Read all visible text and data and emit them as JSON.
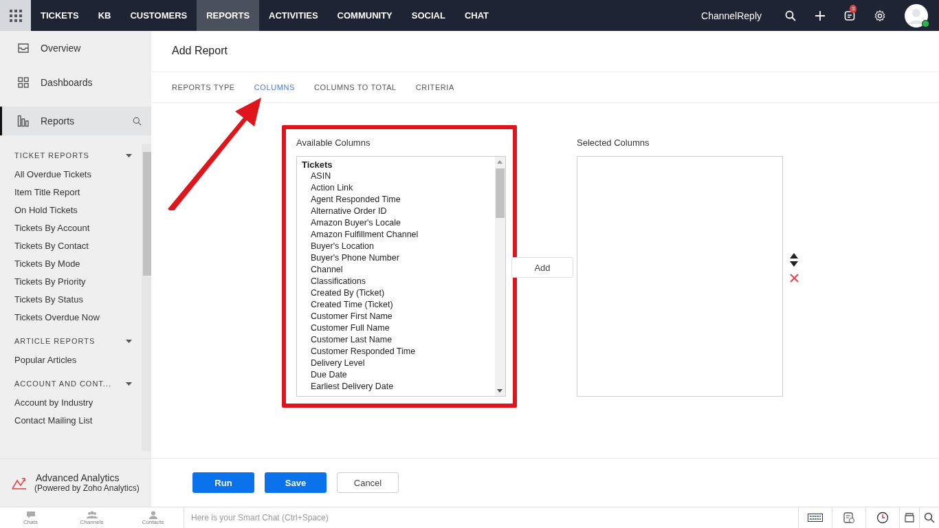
{
  "top_nav": {
    "tabs": [
      {
        "label": "TICKETS",
        "selected": false
      },
      {
        "label": "KB",
        "selected": false
      },
      {
        "label": "CUSTOMERS",
        "selected": false
      },
      {
        "label": "REPORTS",
        "selected": true
      },
      {
        "label": "ACTIVITIES",
        "selected": false
      },
      {
        "label": "COMMUNITY",
        "selected": false
      },
      {
        "label": "SOCIAL",
        "selected": false
      },
      {
        "label": "CHAT",
        "selected": false
      }
    ],
    "org": "ChannelReply",
    "notification_count": "3"
  },
  "sidebar": {
    "nav": [
      {
        "label": "Overview",
        "selected": false
      },
      {
        "label": "Dashboards",
        "selected": false
      },
      {
        "label": "Reports",
        "selected": true
      }
    ],
    "groups": [
      {
        "title": "TICKET REPORTS",
        "items": [
          "All Overdue Tickets",
          "Item Title Report",
          "On Hold Tickets",
          "Tickets By Account",
          "Tickets By Contact",
          "Tickets By Mode",
          "Tickets By Priority",
          "Tickets By Status",
          "Tickets Overdue Now"
        ]
      },
      {
        "title": "ARTICLE REPORTS",
        "items": [
          "Popular Articles"
        ]
      },
      {
        "title": "ACCOUNT AND CONT...",
        "items": [
          "Account by Industry",
          "Contact Mailing List"
        ]
      }
    ],
    "analytics": {
      "title": "Advanced Analytics",
      "subtitle": "(Powered by Zoho Analytics)"
    }
  },
  "page": {
    "title": "Add Report",
    "steps": [
      {
        "label": "REPORTS TYPE",
        "selected": false
      },
      {
        "label": "COLUMNS",
        "selected": true
      },
      {
        "label": "COLUMNS TO TOTAL",
        "selected": false
      },
      {
        "label": "CRITERIA",
        "selected": false
      }
    ],
    "available": {
      "label": "Available Columns",
      "group": "Tickets",
      "items": [
        "ASIN",
        "Action Link",
        "Agent Responded Time",
        "Alternative Order ID",
        "Amazon Buyer's Locale",
        "Amazon Fulfillment Channel",
        "Buyer's Location",
        "Buyer's Phone Number",
        "Channel",
        "Classifications",
        "Created By (Ticket)",
        "Created Time (Ticket)",
        "Customer First Name",
        "Customer Full Name",
        "Customer Last Name",
        "Customer Responded Time",
        "Delivery Level",
        "Due Date",
        "Earliest Delivery Date"
      ]
    },
    "add_button": "Add",
    "selected": {
      "label": "Selected Columns"
    },
    "buttons": [
      "Run",
      "Save",
      "Cancel"
    ]
  },
  "bottom_bar": {
    "tabs": [
      "Chats",
      "Channels",
      "Contacts"
    ],
    "chat_placeholder": "Here is your Smart Chat (Ctrl+Space)"
  }
}
